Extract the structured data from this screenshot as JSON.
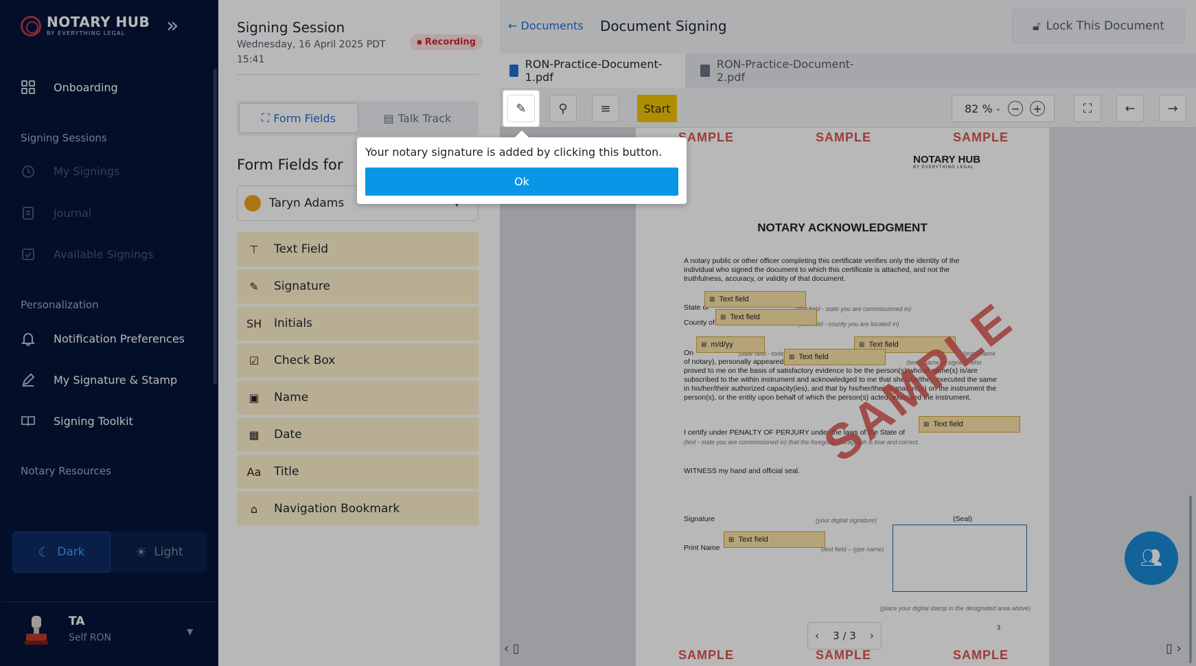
{
  "app": {
    "logo_title": "NOTARY HUB",
    "logo_subtitle": "BY EVERYTHING LEGAL",
    "collapse_icon": "double-chevron-right-icon"
  },
  "sidebar": {
    "onboarding": "Onboarding",
    "section_signing": "Signing Sessions",
    "my_signings": "My Signings",
    "journal": "Journal",
    "available_signings": "Available Signings",
    "section_personalization": "Personalization",
    "notification_preferences": "Notification Preferences",
    "signature_stamp": "My Signature & Stamp",
    "signing_toolkit": "Signing Toolkit",
    "section_resources": "Notary Resources",
    "theme_dark": "Dark",
    "theme_light": "Light",
    "user_initials": "TA",
    "user_role": "Self RON"
  },
  "session": {
    "title": "Signing Session",
    "date": "Wednesday, 16 April 2025   PDT 15:41",
    "recording": "Recording",
    "tab_form_fields": "Form Fields",
    "tab_talk_track": "Talk Track",
    "form_fields_for": "Form Fields for",
    "signer_name": "Taryn Adams",
    "fields": [
      {
        "label": "Text Field",
        "icon": "text-field-icon",
        "glyph": "⊤"
      },
      {
        "label": "Signature",
        "icon": "pen-icon",
        "glyph": "✎"
      },
      {
        "label": "Initials",
        "icon": "initials-icon",
        "glyph": "SH"
      },
      {
        "label": "Check Box",
        "icon": "checkbox-icon",
        "glyph": "☑"
      },
      {
        "label": "Name",
        "icon": "name-icon",
        "glyph": "▣"
      },
      {
        "label": "Date",
        "icon": "calendar-icon",
        "glyph": "▦"
      },
      {
        "label": "Title",
        "icon": "title-icon",
        "glyph": "Aa"
      },
      {
        "label": "Navigation Bookmark",
        "icon": "bookmark-icon",
        "glyph": "⌂"
      }
    ]
  },
  "document": {
    "back_label": "Documents",
    "title": "Document Signing",
    "lock_label": "Lock This Document",
    "tab1": "RON-Practice-Document-1.pdf",
    "tab2": "RON-Practice-Document-2.pdf",
    "start_label": "Start",
    "zoom": "82 %",
    "page_indicator": "3 / 3",
    "page_number": "3"
  },
  "page": {
    "watermark": "SAMPLE",
    "logo": "NOTARY HUB",
    "logo_sub": "BY EVERYTHING LEGAL",
    "heading": "NOTARY ACKNOWLEDGMENT",
    "intro": "A notary public or other officer completing this certificate verifies only the identity of the individual who signed the document to which this certificate is attached, and not the truthfulness, accuracy, or validity of that document.",
    "state_of": "State of",
    "state_hint": "(text field - state you are commissioned in)",
    "county_of": "County of",
    "county_hint": "(text field - county you are located in)",
    "on_line": "On",
    "on_hint": "(date field - today's date) before me,",
    "name_hint": "(text - name",
    "body1": "of notary), personally appeared",
    "signer_hint": "(text - name of signer), who",
    "body2": "proved to me on the basis of satisfactory evidence to be the person(s) whose name(s) is/are subscribed to the within instrument and acknowledged to me that she/she/they executed the same in his/her/their authorized capacity(ies), and that by his/her/their signature(s) on the instrument the person(s), or the entity upon behalf of which the person(s) acted, executed the instrument.",
    "perjury": "I certify under PENALTY OF PERJURY under the laws of the State of",
    "perjury2": "(text - state you are commissioned in) that the foregoing paragraph is true and correct.",
    "witness": "WITNESS my hand and official seal.",
    "signature_label": "Signature",
    "signature_hint": "(your digital signature)",
    "seal_label": "(Seal)",
    "print_name": "Print Name",
    "print_hint": "(text field – type name)",
    "stamp_hint": "(place your digital stamp in the designated area above)",
    "field_text": "Text field",
    "field_date": "m/d/yy"
  },
  "popover": {
    "message": "Your notary signature is added by clicking this button.",
    "ok": "Ok"
  },
  "colors": {
    "sidebar_bg": "#05163a",
    "accent": "#1f6fd6",
    "field_bg": "#fff1cc",
    "start": "#f1c400",
    "ok_button": "#0a96e6"
  }
}
